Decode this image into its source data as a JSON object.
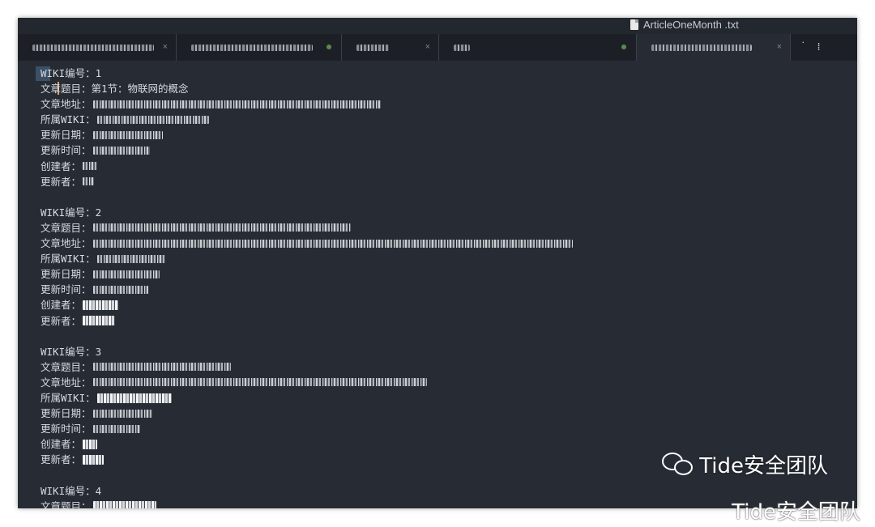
{
  "window": {
    "title": "ArticleOneMonth .txt"
  },
  "tabs": [
    {
      "label": "",
      "active": false
    },
    {
      "label": "",
      "active": false
    },
    {
      "label": "",
      "active": false
    },
    {
      "label": "",
      "active": false
    },
    {
      "label": "",
      "active": true
    }
  ],
  "labels": {
    "wiki_no": "WIKI编号：",
    "title": "文章题目：",
    "address": "文章地址：",
    "wiki": "所属WIKI：",
    "update_date": "更新日期：",
    "update_time": "更新时间：",
    "creator": "创建者：",
    "updater": "更新者："
  },
  "records": [
    {
      "no": "1",
      "title": "第1节：物联网的概念"
    },
    {
      "no": "2",
      "title": ""
    },
    {
      "no": "3",
      "title": ""
    },
    {
      "no": "4",
      "title": ""
    }
  ],
  "watermark": {
    "inner": "Tide安全团队",
    "outer": "Tide安全团队"
  },
  "icons": {
    "file": "document-icon",
    "wechat": "wechat-icon"
  },
  "colors": {
    "editor_bg": "#272c34",
    "tabbar_bg": "#1c2026",
    "text": "#d7dae0",
    "cursor": "#e5a35a"
  }
}
